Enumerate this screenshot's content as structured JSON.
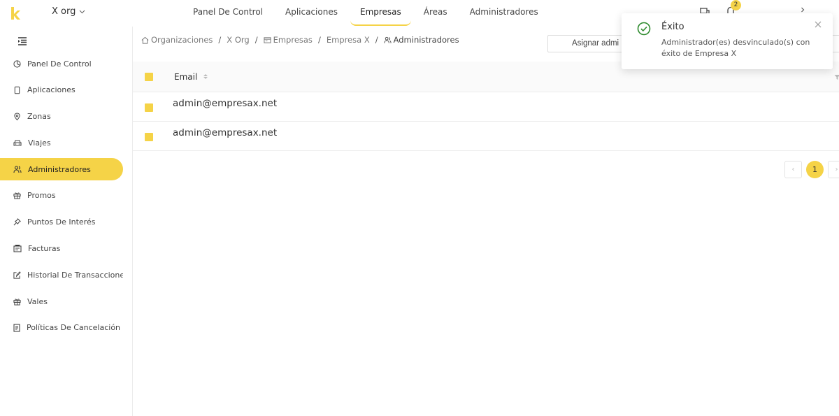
{
  "colors": {
    "accent": "#f5d347",
    "success": "#2e8b2e"
  },
  "header": {
    "logo_letter": "k",
    "org_selector": "X org",
    "nav": [
      {
        "label": "Panel De Control",
        "active": false
      },
      {
        "label": "Aplicaciones",
        "active": false
      },
      {
        "label": "Empresas",
        "active": true
      },
      {
        "label": "Áreas",
        "active": false
      },
      {
        "label": "Administradores",
        "active": false
      }
    ],
    "notification_count": "2",
    "icons": [
      "flag-icon",
      "bell-icon",
      "user-menu-caret-icon"
    ]
  },
  "sidebar": {
    "collapse_icon": "menu-fold-icon",
    "items": [
      {
        "label": "Panel De Control",
        "icon": "pie-chart-icon",
        "active": false
      },
      {
        "label": "Aplicaciones",
        "icon": "phone-icon",
        "active": false
      },
      {
        "label": "Zonas",
        "icon": "location-icon",
        "active": false
      },
      {
        "label": "Viajes",
        "icon": "car-icon",
        "active": false
      },
      {
        "label": "Administradores",
        "icon": "users-icon",
        "active": true
      },
      {
        "label": "Promos",
        "icon": "gift-icon",
        "active": false
      },
      {
        "label": "Puntos De Interés",
        "icon": "pushpin-icon",
        "active": false
      },
      {
        "label": "Facturas",
        "icon": "invoice-icon",
        "active": false
      },
      {
        "label": "Historial De Transacciones",
        "icon": "edit-icon",
        "active": false
      },
      {
        "label": "Vales",
        "icon": "gift-icon",
        "active": false
      },
      {
        "label": "Políticas De Cancelación",
        "icon": "file-icon",
        "active": false
      }
    ]
  },
  "breadcrumb": [
    {
      "label": "Organizaciones",
      "icon": "home-icon"
    },
    {
      "label": "X Org",
      "icon": ""
    },
    {
      "label": "Empresas",
      "icon": "building-icon"
    },
    {
      "label": "Empresa X",
      "icon": ""
    },
    {
      "label": "Administradores",
      "icon": "users-icon"
    }
  ],
  "actions": {
    "assign_button": "Asignar admi"
  },
  "table": {
    "columns": [
      "Email"
    ],
    "rows": [
      {
        "email": "admin@empresax.net"
      },
      {
        "email": "admin@empresax.net"
      }
    ]
  },
  "pagination": {
    "current_page": "1",
    "prev": "‹",
    "next": "›"
  },
  "toast": {
    "type": "success",
    "title": "Éxito",
    "message": "Administrador(es) desvinculado(s) con éxito de Empresa X",
    "close": "×"
  }
}
